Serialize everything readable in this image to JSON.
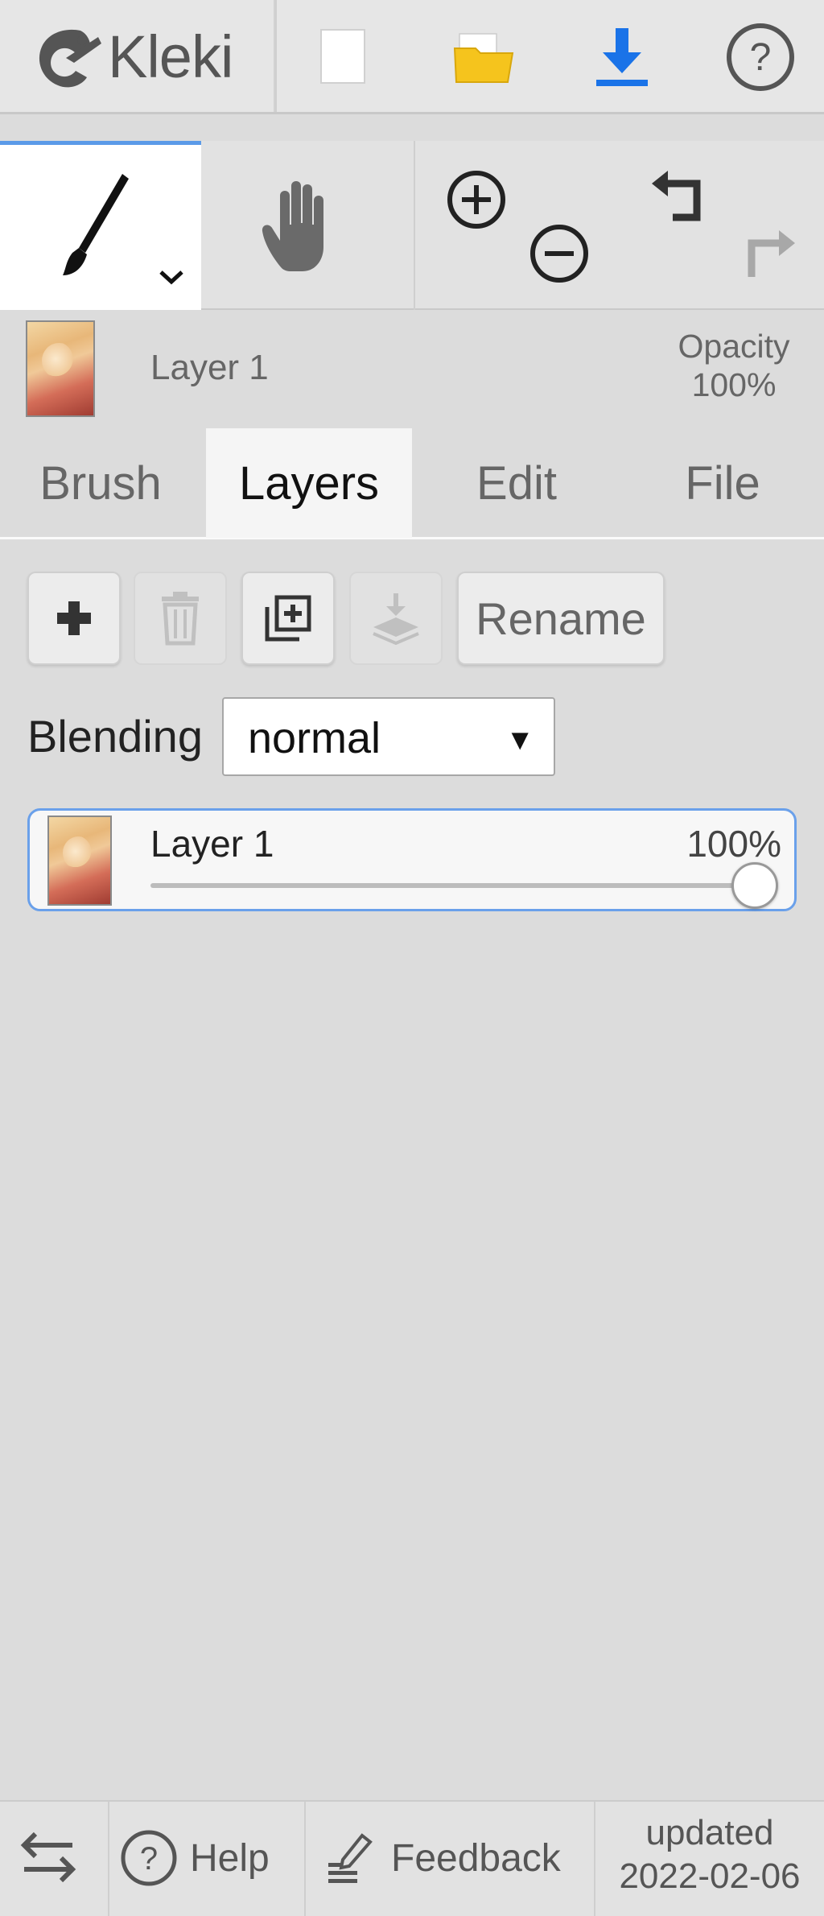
{
  "app": {
    "logo_text": "Kleki"
  },
  "toolbar": {
    "icons": [
      "new-file-icon",
      "open-folder-icon",
      "download-icon",
      "help-icon"
    ],
    "accent_color": "#1a73e8",
    "folder_color": "#f5c41d"
  },
  "tools": {
    "active_tool": "brush",
    "icons": [
      "brush-icon",
      "chevron-down-icon",
      "hand-icon",
      "zoom-in-icon",
      "zoom-out-icon",
      "undo-icon",
      "redo-icon"
    ]
  },
  "layer_summary": {
    "name": "Layer 1",
    "opacity_label": "Opacity",
    "opacity_value": "100%"
  },
  "tabs": [
    {
      "label": "Brush",
      "active": false
    },
    {
      "label": "Layers",
      "active": true
    },
    {
      "label": "Edit",
      "active": false
    },
    {
      "label": "File",
      "active": false
    }
  ],
  "layer_actions": {
    "rename_label": "Rename",
    "icons": [
      "add-layer-icon",
      "delete-layer-icon",
      "duplicate-layer-icon",
      "merge-down-icon"
    ]
  },
  "blending": {
    "label": "Blending",
    "value": "normal"
  },
  "layers": [
    {
      "name": "Layer 1",
      "opacity_label": "100%",
      "opacity": 1.0,
      "selected": true
    }
  ],
  "footer": {
    "help_label": "Help",
    "feedback_label": "Feedback",
    "updated_label": "updated",
    "updated_date": "2022-02-06"
  }
}
